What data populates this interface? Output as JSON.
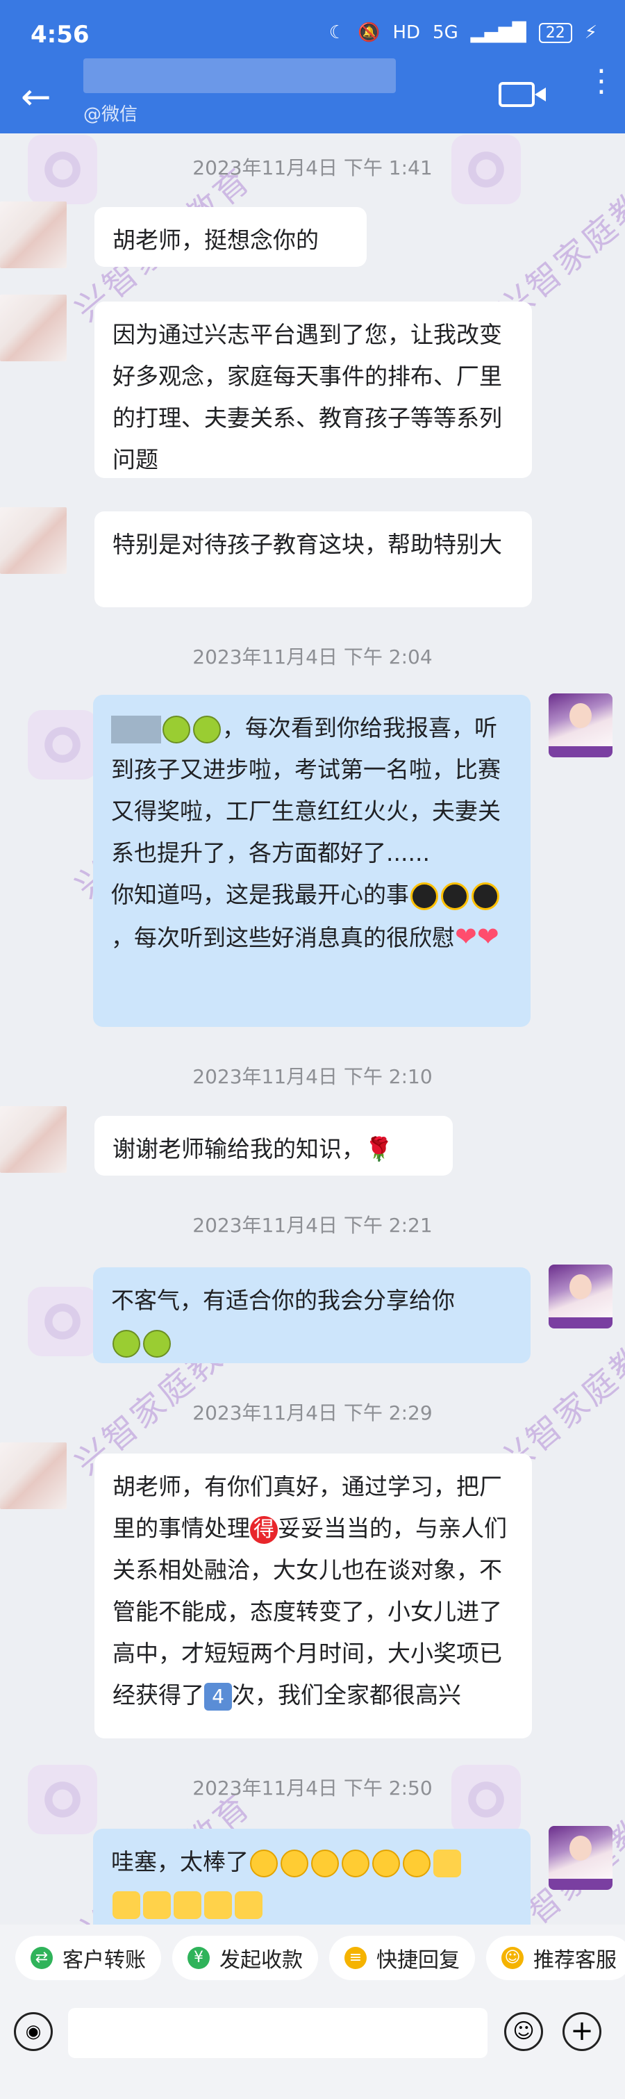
{
  "status_bar": {
    "time": "4:56",
    "network": "5G",
    "battery": "22"
  },
  "header": {
    "back_icon": "back-arrow-icon",
    "subtitle": "@微信",
    "video_icon": "video-call-icon",
    "more_icon": "more-vertical-icon"
  },
  "watermark": {
    "text": "兴智家庭教育"
  },
  "messages": [
    {
      "timestamp": "2023年11月4日  下午 1:41"
    },
    {
      "from": "other",
      "text": "胡老师，挺想念你的"
    },
    {
      "from": "other",
      "text": "因为通过兴志平台遇到了您，让我改变好多观念，家庭每天事件的排布、厂里的打理、夫妻关系、教育孩子等等系列问题"
    },
    {
      "from": "other",
      "text": "特别是对待孩子教育这块，帮助特别大"
    },
    {
      "timestamp": "2023年11月4日  下午 2:04"
    },
    {
      "from": "me",
      "text_a": "，每次看到你给我报喜，听到孩子又进步啦，考试第一名啦，比赛又得奖啦，工厂生意红红火火，夫妻关系也提升了，各方面都好了......",
      "text_b": "你知道吗，这是我最开心的事",
      "text_c": "，每次听到这些好消息真的很欣慰"
    },
    {
      "timestamp": "2023年11月4日  下午 2:10"
    },
    {
      "from": "other",
      "text": "谢谢老师输给我的知识，"
    },
    {
      "timestamp": "2023年11月4日  下午 2:21"
    },
    {
      "from": "me",
      "text": "不客气，有适合你的我会分享给你"
    },
    {
      "timestamp": "2023年11月4日  下午 2:29"
    },
    {
      "from": "other",
      "text_a": "胡老师，有你们真好，通过学习，把厂里的事情处理",
      "highlight": "得",
      "text_b": "妥妥当当的，与亲人们关系相处融洽，大女儿也在谈对象，不管能不能成，态度转变了，小女儿进了高中，才短短两个月时间，大小奖项已经获得了",
      "badge": "4",
      "text_c": "次，我们全家都很高兴"
    },
    {
      "timestamp": "2023年11月4日  下午 2:50"
    },
    {
      "from": "me",
      "text": "哇塞，太棒了"
    }
  ],
  "quick_actions": [
    {
      "label": "客户转账",
      "icon": "transfer-icon",
      "color": "#2fb35a"
    },
    {
      "label": "发起收款",
      "icon": "yuan-shield-icon",
      "color": "#2fb35a"
    },
    {
      "label": "快捷回复",
      "icon": "quick-reply-icon",
      "color": "#f5b300"
    },
    {
      "label": "推荐客服",
      "icon": "recommend-icon",
      "color": "#f5b300"
    }
  ],
  "input_bar": {
    "voice_icon": "voice-icon",
    "emoji_icon": "smile-icon",
    "plus_icon": "plus-icon"
  }
}
